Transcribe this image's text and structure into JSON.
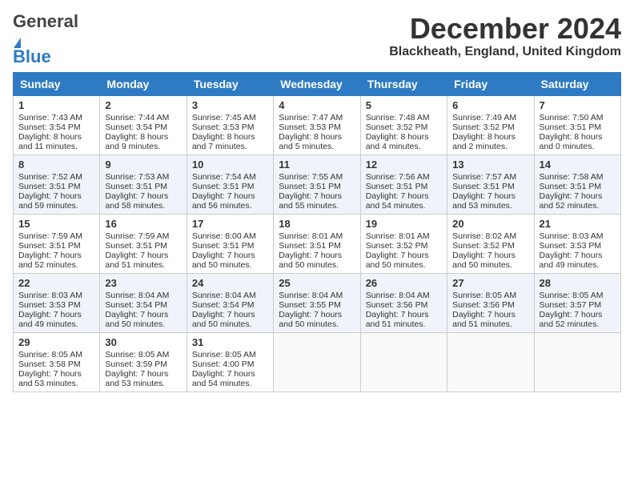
{
  "logo": {
    "line1": "General",
    "line2": "Blue"
  },
  "header": {
    "month_year": "December 2024",
    "location": "Blackheath, England, United Kingdom"
  },
  "days_of_week": [
    "Sunday",
    "Monday",
    "Tuesday",
    "Wednesday",
    "Thursday",
    "Friday",
    "Saturday"
  ],
  "weeks": [
    [
      {
        "day": "1",
        "lines": [
          "Sunrise: 7:43 AM",
          "Sunset: 3:54 PM",
          "Daylight: 8 hours",
          "and 11 minutes."
        ]
      },
      {
        "day": "2",
        "lines": [
          "Sunrise: 7:44 AM",
          "Sunset: 3:54 PM",
          "Daylight: 8 hours",
          "and 9 minutes."
        ]
      },
      {
        "day": "3",
        "lines": [
          "Sunrise: 7:45 AM",
          "Sunset: 3:53 PM",
          "Daylight: 8 hours",
          "and 7 minutes."
        ]
      },
      {
        "day": "4",
        "lines": [
          "Sunrise: 7:47 AM",
          "Sunset: 3:53 PM",
          "Daylight: 8 hours",
          "and 5 minutes."
        ]
      },
      {
        "day": "5",
        "lines": [
          "Sunrise: 7:48 AM",
          "Sunset: 3:52 PM",
          "Daylight: 8 hours",
          "and 4 minutes."
        ]
      },
      {
        "day": "6",
        "lines": [
          "Sunrise: 7:49 AM",
          "Sunset: 3:52 PM",
          "Daylight: 8 hours",
          "and 2 minutes."
        ]
      },
      {
        "day": "7",
        "lines": [
          "Sunrise: 7:50 AM",
          "Sunset: 3:51 PM",
          "Daylight: 8 hours",
          "and 0 minutes."
        ]
      }
    ],
    [
      {
        "day": "8",
        "lines": [
          "Sunrise: 7:52 AM",
          "Sunset: 3:51 PM",
          "Daylight: 7 hours",
          "and 59 minutes."
        ]
      },
      {
        "day": "9",
        "lines": [
          "Sunrise: 7:53 AM",
          "Sunset: 3:51 PM",
          "Daylight: 7 hours",
          "and 58 minutes."
        ]
      },
      {
        "day": "10",
        "lines": [
          "Sunrise: 7:54 AM",
          "Sunset: 3:51 PM",
          "Daylight: 7 hours",
          "and 56 minutes."
        ]
      },
      {
        "day": "11",
        "lines": [
          "Sunrise: 7:55 AM",
          "Sunset: 3:51 PM",
          "Daylight: 7 hours",
          "and 55 minutes."
        ]
      },
      {
        "day": "12",
        "lines": [
          "Sunrise: 7:56 AM",
          "Sunset: 3:51 PM",
          "Daylight: 7 hours",
          "and 54 minutes."
        ]
      },
      {
        "day": "13",
        "lines": [
          "Sunrise: 7:57 AM",
          "Sunset: 3:51 PM",
          "Daylight: 7 hours",
          "and 53 minutes."
        ]
      },
      {
        "day": "14",
        "lines": [
          "Sunrise: 7:58 AM",
          "Sunset: 3:51 PM",
          "Daylight: 7 hours",
          "and 52 minutes."
        ]
      }
    ],
    [
      {
        "day": "15",
        "lines": [
          "Sunrise: 7:59 AM",
          "Sunset: 3:51 PM",
          "Daylight: 7 hours",
          "and 52 minutes."
        ]
      },
      {
        "day": "16",
        "lines": [
          "Sunrise: 7:59 AM",
          "Sunset: 3:51 PM",
          "Daylight: 7 hours",
          "and 51 minutes."
        ]
      },
      {
        "day": "17",
        "lines": [
          "Sunrise: 8:00 AM",
          "Sunset: 3:51 PM",
          "Daylight: 7 hours",
          "and 50 minutes."
        ]
      },
      {
        "day": "18",
        "lines": [
          "Sunrise: 8:01 AM",
          "Sunset: 3:51 PM",
          "Daylight: 7 hours",
          "and 50 minutes."
        ]
      },
      {
        "day": "19",
        "lines": [
          "Sunrise: 8:01 AM",
          "Sunset: 3:52 PM",
          "Daylight: 7 hours",
          "and 50 minutes."
        ]
      },
      {
        "day": "20",
        "lines": [
          "Sunrise: 8:02 AM",
          "Sunset: 3:52 PM",
          "Daylight: 7 hours",
          "and 50 minutes."
        ]
      },
      {
        "day": "21",
        "lines": [
          "Sunrise: 8:03 AM",
          "Sunset: 3:53 PM",
          "Daylight: 7 hours",
          "and 49 minutes."
        ]
      }
    ],
    [
      {
        "day": "22",
        "lines": [
          "Sunrise: 8:03 AM",
          "Sunset: 3:53 PM",
          "Daylight: 7 hours",
          "and 49 minutes."
        ]
      },
      {
        "day": "23",
        "lines": [
          "Sunrise: 8:04 AM",
          "Sunset: 3:54 PM",
          "Daylight: 7 hours",
          "and 50 minutes."
        ]
      },
      {
        "day": "24",
        "lines": [
          "Sunrise: 8:04 AM",
          "Sunset: 3:54 PM",
          "Daylight: 7 hours",
          "and 50 minutes."
        ]
      },
      {
        "day": "25",
        "lines": [
          "Sunrise: 8:04 AM",
          "Sunset: 3:55 PM",
          "Daylight: 7 hours",
          "and 50 minutes."
        ]
      },
      {
        "day": "26",
        "lines": [
          "Sunrise: 8:04 AM",
          "Sunset: 3:56 PM",
          "Daylight: 7 hours",
          "and 51 minutes."
        ]
      },
      {
        "day": "27",
        "lines": [
          "Sunrise: 8:05 AM",
          "Sunset: 3:56 PM",
          "Daylight: 7 hours",
          "and 51 minutes."
        ]
      },
      {
        "day": "28",
        "lines": [
          "Sunrise: 8:05 AM",
          "Sunset: 3:57 PM",
          "Daylight: 7 hours",
          "and 52 minutes."
        ]
      }
    ],
    [
      {
        "day": "29",
        "lines": [
          "Sunrise: 8:05 AM",
          "Sunset: 3:58 PM",
          "Daylight: 7 hours",
          "and 53 minutes."
        ]
      },
      {
        "day": "30",
        "lines": [
          "Sunrise: 8:05 AM",
          "Sunset: 3:59 PM",
          "Daylight: 7 hours",
          "and 53 minutes."
        ]
      },
      {
        "day": "31",
        "lines": [
          "Sunrise: 8:05 AM",
          "Sunset: 4:00 PM",
          "Daylight: 7 hours",
          "and 54 minutes."
        ]
      },
      {
        "day": "",
        "lines": []
      },
      {
        "day": "",
        "lines": []
      },
      {
        "day": "",
        "lines": []
      },
      {
        "day": "",
        "lines": []
      }
    ]
  ]
}
